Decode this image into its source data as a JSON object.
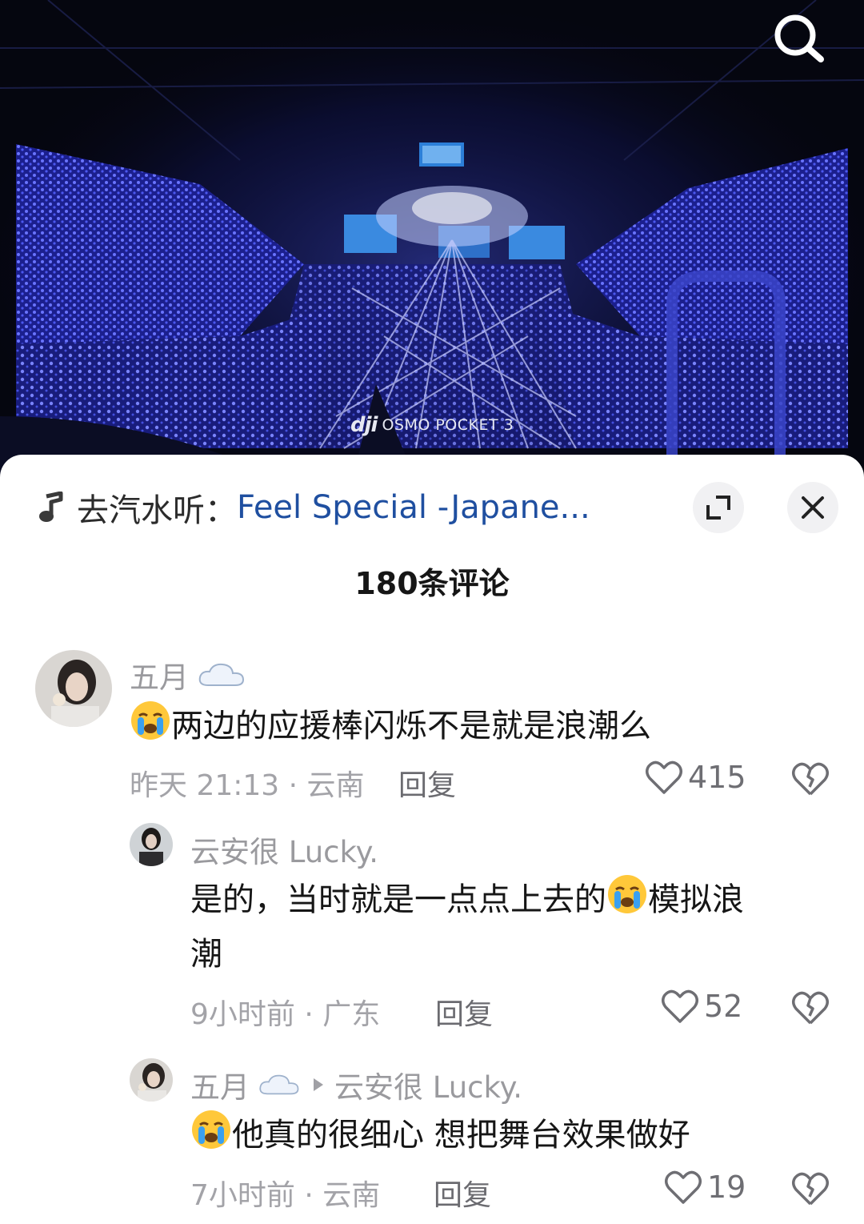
{
  "video": {
    "watermark_brand": "dji",
    "watermark_text": "OSMO POCKET 3",
    "search_icon": "search-icon"
  },
  "music": {
    "prefix": "去汽水听：",
    "song": "Feel Special -Japane...",
    "icon": "music-note-icon"
  },
  "header": {
    "comment_count": "180条评论",
    "expand_icon": "expand-icon",
    "close_icon": "close-icon"
  },
  "comments": [
    {
      "user": "五月",
      "text": "两边的应援棒闪烁不是就是浪潮么",
      "time": "昨天 21:13",
      "location": "云南",
      "meta": "昨天 21:13 · 云南",
      "reply": "回复",
      "likes": "415"
    },
    {
      "user": "云安很 Lucky.",
      "text_part1": "是的，当时就是一点点上去的",
      "text_part2": "模拟浪",
      "text_part3": "潮",
      "meta": "9小时前 · 广东",
      "reply": "回复",
      "likes": "52"
    },
    {
      "user": "五月",
      "reply_to": "云安很 Lucky.",
      "text": "他真的很细心 想把舞台效果做好",
      "meta": "7小时前 · 云南",
      "reply": "回复",
      "likes": "19"
    }
  ],
  "colors": {
    "link_blue": "#1f4fa0",
    "text_primary": "#161616",
    "text_secondary": "#9a9a9e",
    "stage_blue": "#2f3fe0"
  }
}
